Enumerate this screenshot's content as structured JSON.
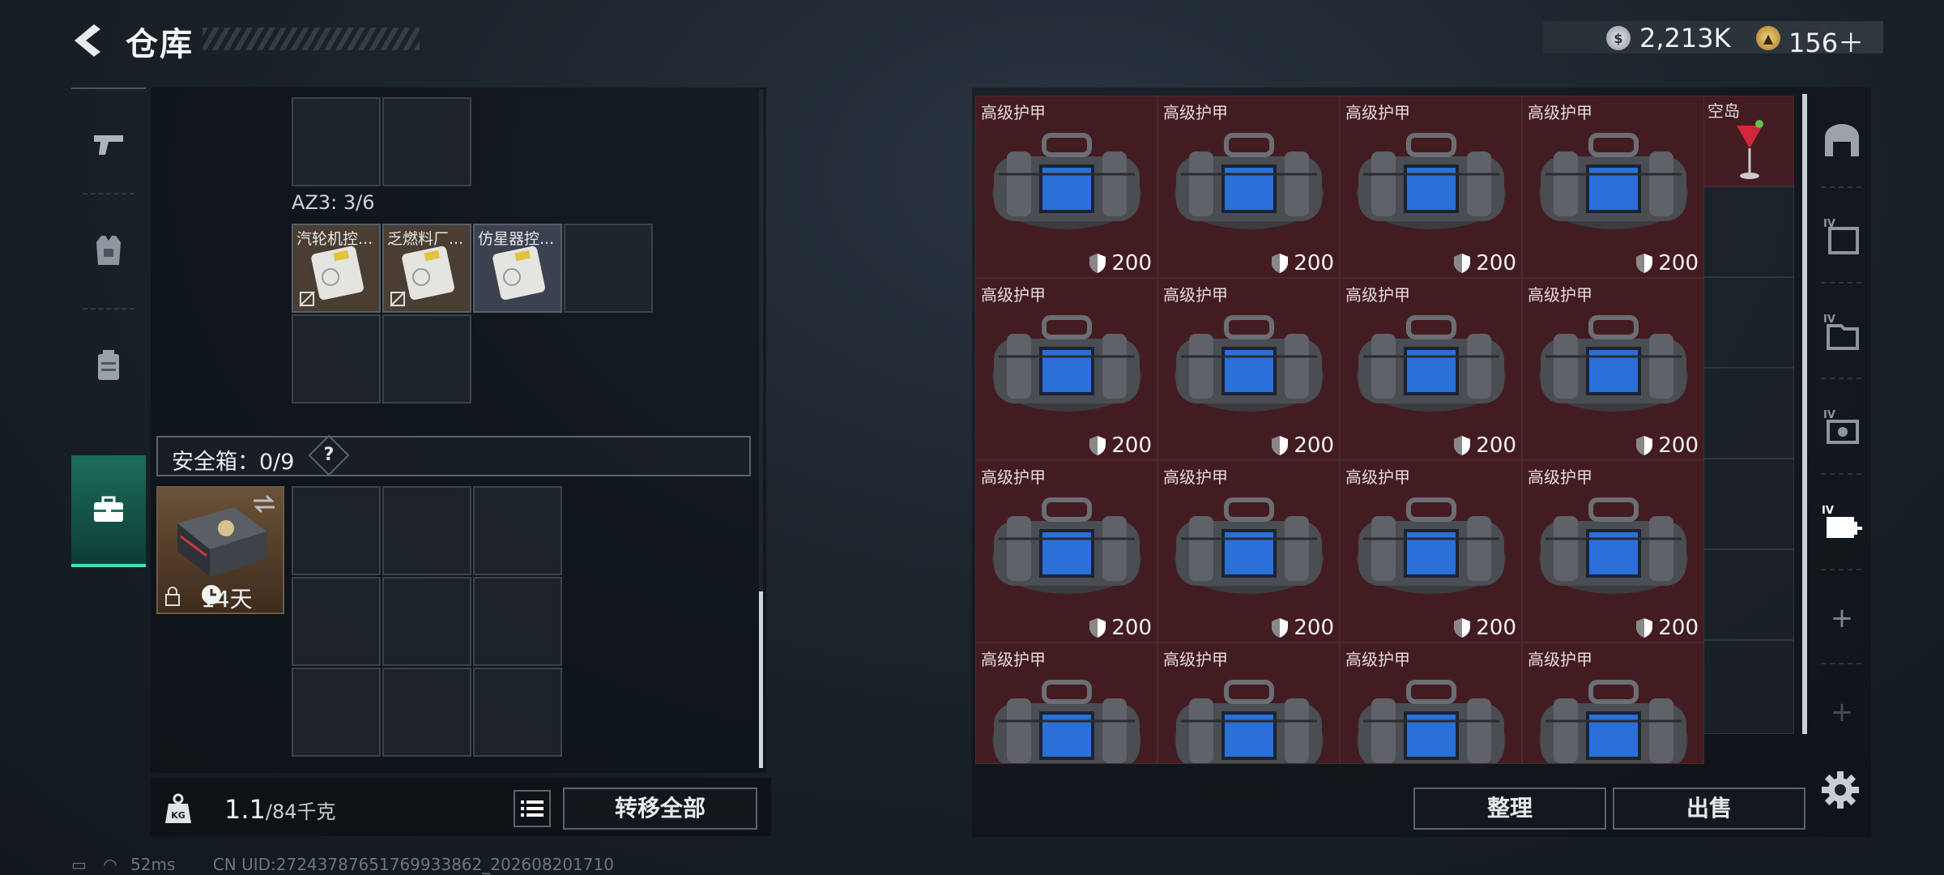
{
  "header": {
    "title": "仓库"
  },
  "currency": {
    "silver": "2,213K",
    "gold": "156＋"
  },
  "left": {
    "container_label": "AZ3: 3/6",
    "items": [
      {
        "name": "汽轮机控..."
      },
      {
        "name": "乏燃料厂..."
      },
      {
        "name": "仿星器控..."
      }
    ],
    "safe_label": "安全箱：0/9",
    "safe_help": "?",
    "safe_days": "14天",
    "weight_value": "1.1",
    "weight_max": "/84千克",
    "transfer_all": "转移全部"
  },
  "right": {
    "armor_name": "高级护甲",
    "armor_durability": "200",
    "other_item_name": "空岛",
    "sort": "整理",
    "sell": "出售"
  },
  "status": {
    "ping": "52ms",
    "uid": "CN UID:2724378765176993386​2_202608201710"
  },
  "colors": {
    "armor_bg": "#431c22",
    "active_tab": "#1d6d5c",
    "accent": "#3fe0b8"
  }
}
